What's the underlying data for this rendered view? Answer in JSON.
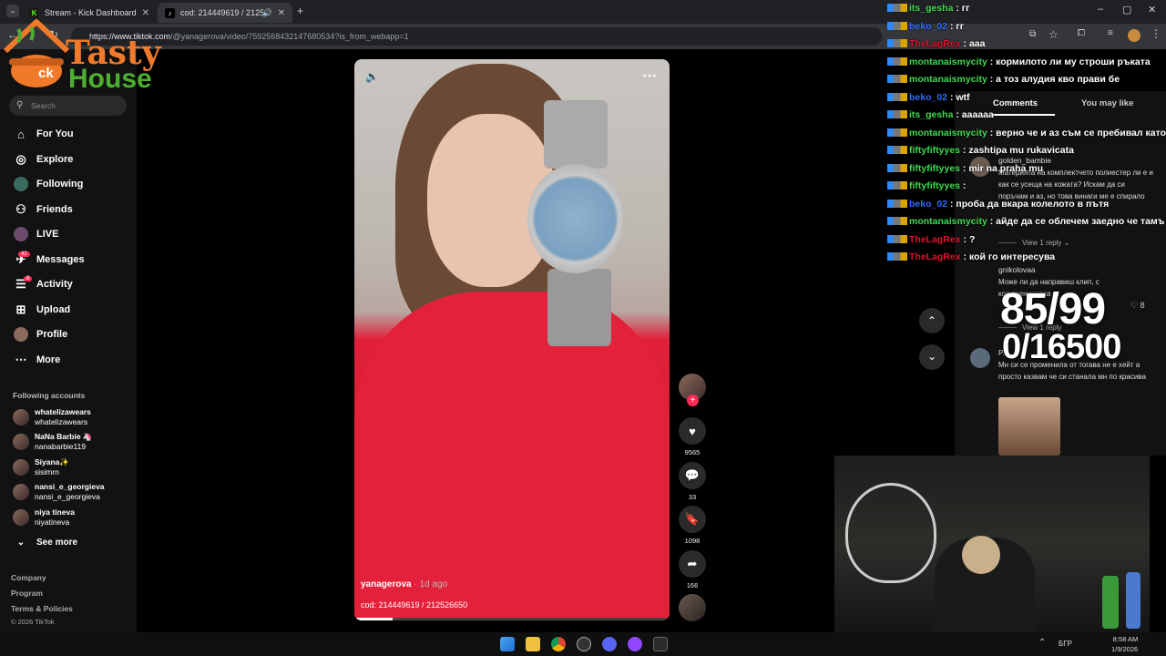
{
  "browser": {
    "tabs": [
      {
        "title": "Stream - Kick Dashboard",
        "icon": "kick-icon"
      },
      {
        "title": "cod: 214449619 / 2125266",
        "icon": "tiktok-icon"
      }
    ],
    "url_host": "https://www.tiktok.com",
    "url_path": "/@yanagerova/video/7592568432147680534?is_from_webapp=1"
  },
  "logo": {
    "line1": "Tasty",
    "line2": "House",
    "behind": "ck"
  },
  "sidebar": {
    "search_placeholder": "Search",
    "nav": [
      {
        "label": "For You",
        "icon": "home-icon"
      },
      {
        "label": "Explore",
        "icon": "compass-icon"
      },
      {
        "label": "Following",
        "icon": "following-icon"
      },
      {
        "label": "Friends",
        "icon": "friends-icon"
      },
      {
        "label": "LIVE",
        "icon": "live-icon"
      },
      {
        "label": "Messages",
        "icon": "messages-icon",
        "badge": "42"
      },
      {
        "label": "Activity",
        "icon": "activity-icon",
        "badge": "8"
      },
      {
        "label": "Upload",
        "icon": "upload-icon"
      },
      {
        "label": "Profile",
        "icon": "profile-icon"
      },
      {
        "label": "More",
        "icon": "more-icon"
      }
    ],
    "following_title": "Following accounts",
    "accounts": [
      {
        "name": "whatelizawears",
        "handle": "whatelizawears"
      },
      {
        "name": "NaNa Barbie 🦄",
        "handle": "nanabarbie119"
      },
      {
        "name": "Siyana✨",
        "handle": "sisimrn"
      },
      {
        "name": "nansi_e_georgieva",
        "handle": "nansi_e_georgieva"
      },
      {
        "name": "niya tineva",
        "handle": "niyatineva"
      }
    ],
    "see_more": "See more",
    "footer": [
      "Company",
      "Program",
      "Terms & Policies"
    ],
    "copyright": "© 2026 TikTok"
  },
  "video": {
    "username": "yanagerova",
    "age": " · 1d ago",
    "description": "cod: 214449619 / 212526650",
    "likes": "9565",
    "comments": "33",
    "saves": "1098",
    "shares": "166"
  },
  "comments_panel": {
    "tabs": [
      "Comments",
      "You may like"
    ],
    "items": [
      {
        "user": "golden_bambie",
        "text": "Материята на комплектчето полиестер ли е и как се усеща на кожата? Искам да си поръчам и аз, но това винаги ме е спирало",
        "reply": "View 1 reply"
      },
      {
        "user": "gnikolovaa",
        "text": "Може ли да направиш клип, с коя тренировка от ...",
        "likes": "8",
        "reply": "View 1 reply"
      },
      {
        "user": "P....",
        "text": "Мн си се променила от тогава не е хейт а просто казвам че си станала мн по красива"
      }
    ]
  },
  "chat": [
    {
      "user": "its_gesha",
      "color": "#3fd94f",
      "msg": "гг"
    },
    {
      "user": "beko_02",
      "color": "#2f6bff",
      "msg": "гг"
    },
    {
      "user": "TheLagRex",
      "color": "#e0102c",
      "msg": "ааа"
    },
    {
      "user": "montanaismycity",
      "color": "#3fd94f",
      "msg": "кормилото ли му строши ръката"
    },
    {
      "user": "montanaismycity",
      "color": "#3fd94f",
      "msg": "а тоз алудия кво прави бе"
    },
    {
      "user": "beko_02",
      "color": "#2f6bff",
      "msg": "wtf"
    },
    {
      "user": "its_gesha",
      "color": "#3fd94f",
      "msg": "аааааа"
    },
    {
      "user": "montanaismycity",
      "color": "#3fd94f",
      "msg": "верно че и аз съм се пребивал като"
    },
    {
      "user": "fiftyfiftyyes",
      "color": "#3fd94f",
      "msg": "zashtipa mu rukavicata"
    },
    {
      "user": "fiftyfiftyyes",
      "color": "#3fd94f",
      "msg": "mir na praha mu"
    },
    {
      "user": "fiftyfiftyyes",
      "color": "#3fd94f",
      "msg": ""
    },
    {
      "user": "beko_02",
      "color": "#2f6bff",
      "msg": "проба да вкара колелото в пътя"
    },
    {
      "user": "montanaismycity",
      "color": "#3fd94f",
      "msg": "айде да се облечем заедно че тамъ"
    },
    {
      "user": "TheLagRex",
      "color": "#e0102c",
      "msg": "?"
    },
    {
      "user": "TheLagRex",
      "color": "#e0102c",
      "msg": "кой го интересува"
    }
  ],
  "counter": {
    "line1": "85/99",
    "line2": "0/16500"
  },
  "taskbar": {
    "lang": "БГР",
    "time": "8:58 AM",
    "date": "1/9/2026"
  },
  "colors": {
    "tiktok_red": "#fe2c55",
    "hoodie": "#e4213b",
    "logo_orange": "#f07a2a",
    "logo_green": "#4caf2f"
  }
}
